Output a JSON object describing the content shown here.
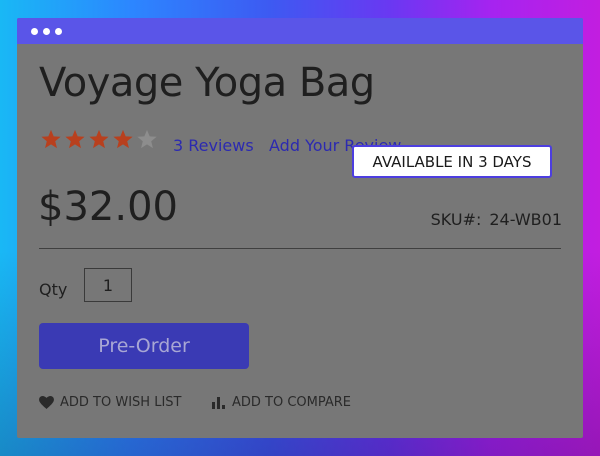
{
  "product": {
    "title": "Voyage Yoga Bag",
    "rating": 4,
    "rating_max": 5,
    "reviews_label": "3 Reviews",
    "add_review_label": "Add Your Review",
    "price": "$32.00",
    "availability": "AVAILABLE IN 3 DAYS",
    "sku_label": "SKU#:",
    "sku_value": "24-WB01"
  },
  "quantity": {
    "label": "Qty",
    "value": "1"
  },
  "actions": {
    "preorder_label": "Pre-Order",
    "wishlist_label": "ADD TO WISH LIST",
    "compare_label": "ADD TO COMPARE"
  },
  "icons": {
    "wishlist": "heart-icon",
    "compare": "bar-chart-icon"
  },
  "colors": {
    "star_filled": "#b8401e",
    "star_empty": "#8d8d8d",
    "accent": "#3a3ab4",
    "link": "#2c2ab0"
  }
}
